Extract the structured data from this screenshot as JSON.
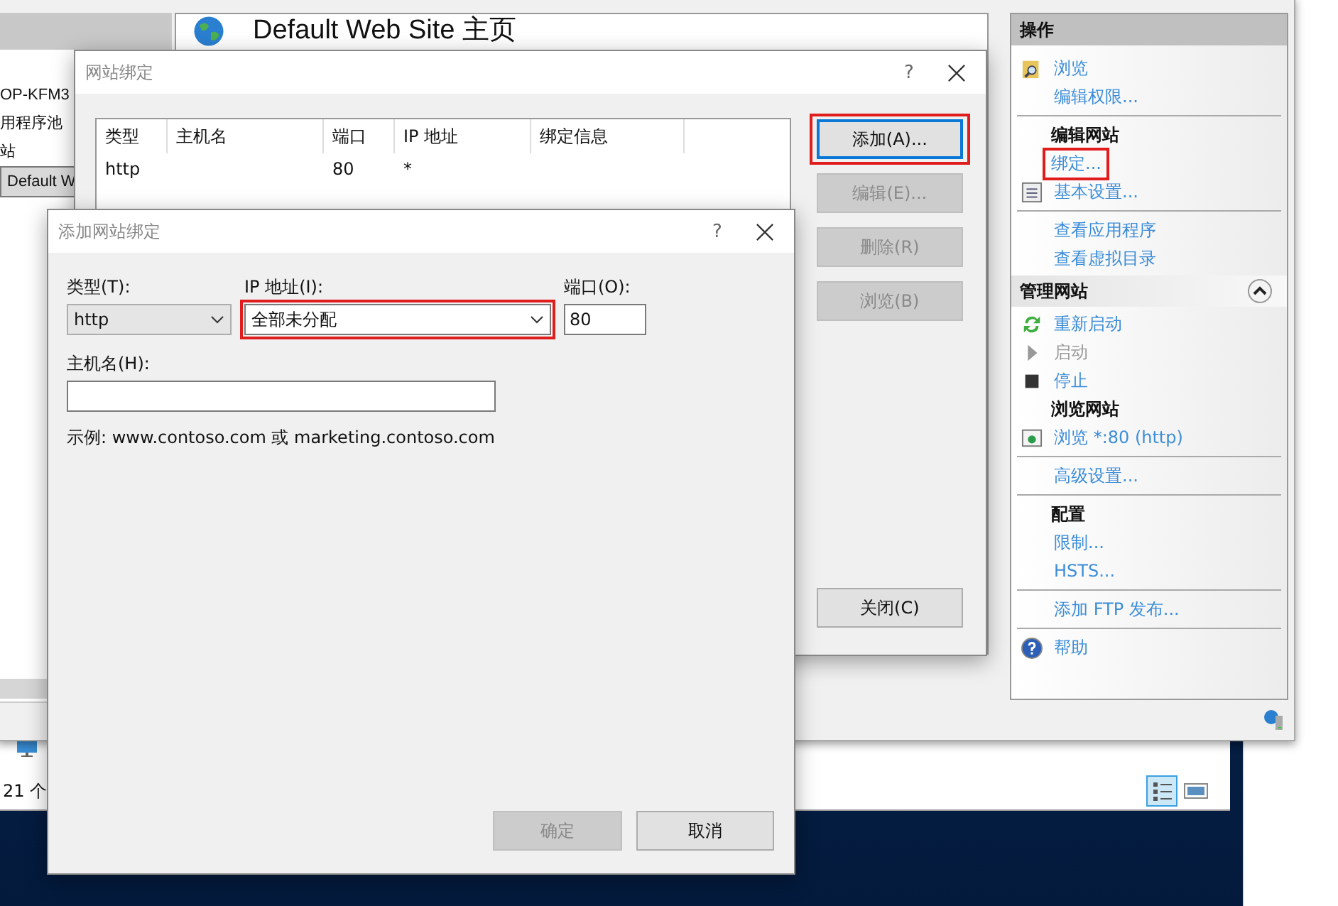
{
  "iis": {
    "tree": [
      {
        "label": "OP-KFM3",
        "selected": false
      },
      {
        "label": "用程序池",
        "selected": false
      },
      {
        "label": "站",
        "selected": false
      },
      {
        "label": "Default W",
        "selected": true
      }
    ],
    "page_title": "Default Web Site 主页",
    "actions": [
      {
        "kind": "header",
        "label": "操作"
      },
      {
        "kind": "browse",
        "label": "浏览",
        "disabled": false,
        "highlighted": false
      },
      {
        "kind": "link",
        "label": "编辑权限...",
        "disabled": false,
        "highlighted": false
      },
      {
        "kind": "divider"
      },
      {
        "kind": "heading",
        "label": "编辑网站"
      },
      {
        "kind": "link",
        "label": "绑定...",
        "disabled": false,
        "highlighted": true
      },
      {
        "kind": "settings",
        "label": "基本设置...",
        "disabled": false,
        "highlighted": false
      },
      {
        "kind": "divider"
      },
      {
        "kind": "link",
        "label": "查看应用程序",
        "disabled": false,
        "highlighted": false
      },
      {
        "kind": "link",
        "label": "查看虚拟目录",
        "disabled": false,
        "highlighted": false
      },
      {
        "kind": "section",
        "label": "管理网站",
        "expanded": true
      },
      {
        "kind": "restart",
        "label": "重新启动",
        "disabled": false,
        "highlighted": false
      },
      {
        "kind": "start",
        "label": "启动",
        "disabled": true,
        "highlighted": false
      },
      {
        "kind": "stop",
        "label": "停止",
        "disabled": false,
        "highlighted": false
      },
      {
        "kind": "heading",
        "label": "浏览网站"
      },
      {
        "kind": "site",
        "label": "浏览 *:80 (http)",
        "disabled": false,
        "highlighted": false
      },
      {
        "kind": "divider"
      },
      {
        "kind": "link",
        "label": "高级设置...",
        "disabled": false,
        "highlighted": false
      },
      {
        "kind": "divider"
      },
      {
        "kind": "heading",
        "label": "配置"
      },
      {
        "kind": "link",
        "label": "限制...",
        "disabled": false,
        "highlighted": false
      },
      {
        "kind": "link",
        "label": "HSTS...",
        "disabled": false,
        "highlighted": false
      },
      {
        "kind": "divider"
      },
      {
        "kind": "link",
        "label": "添加 FTP 发布...",
        "disabled": false,
        "highlighted": false
      },
      {
        "kind": "divider"
      },
      {
        "kind": "help",
        "label": "帮助",
        "disabled": false,
        "highlighted": false
      }
    ]
  },
  "explorer": {
    "status": "21 个"
  },
  "bindings_dialog": {
    "title": "网站绑定",
    "help": "?",
    "columns": [
      "类型",
      "主机名",
      "端口",
      "IP 地址",
      "绑定信息"
    ],
    "rows": [
      {
        "cells": [
          "http",
          null,
          "80",
          "*",
          null
        ]
      }
    ],
    "buttons": [
      {
        "label": "添加(A)...",
        "disabled": false,
        "focused": true,
        "highlighted": true
      },
      {
        "label": "编辑(E)...",
        "disabled": true,
        "focused": false,
        "highlighted": false
      },
      {
        "label": "删除(R)",
        "disabled": true,
        "focused": false,
        "highlighted": false
      },
      {
        "label": "浏览(B)",
        "disabled": true,
        "focused": false,
        "highlighted": false
      }
    ],
    "close_button": "关闭(C)"
  },
  "add_dialog": {
    "title": "添加网站绑定",
    "help": "?",
    "type": {
      "label": "类型(T):",
      "value": "http"
    },
    "ip": {
      "label": "IP 地址(I):",
      "value": "全部未分配",
      "highlighted": true
    },
    "port": {
      "label": "端口(O):",
      "value": "80"
    },
    "host": {
      "label": "主机名(H):"
    },
    "example": "示例: www.contoso.com 或 marketing.contoso.com",
    "buttons": [
      {
        "label": "确定",
        "disabled": true
      },
      {
        "label": "取消",
        "disabled": false
      }
    ]
  }
}
